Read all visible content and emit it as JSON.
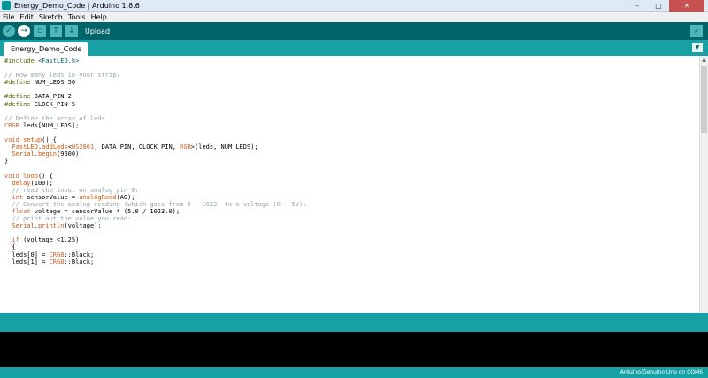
{
  "window": {
    "title": "Energy_Demo_Code | Arduino 1.8.6",
    "minimize": "–",
    "maximize": "□",
    "close": "✕"
  },
  "menu": [
    "File",
    "Edit",
    "Sketch",
    "Tools",
    "Help"
  ],
  "toolbar": {
    "hover_label": "Upload"
  },
  "tabs": [
    {
      "label": "Energy_Demo_Code"
    }
  ],
  "code_lines": [
    [
      [
        "dir",
        "#include "
      ],
      [
        "lit",
        "<FastLED.h>"
      ]
    ],
    [],
    [
      [
        "cmt",
        "// How many leds in your strip?"
      ]
    ],
    [
      [
        "dir",
        "#define "
      ],
      [
        "",
        "NUM_LEDS 50"
      ]
    ],
    [],
    [
      [
        "dir",
        "#define "
      ],
      [
        "",
        "DATA_PIN 2"
      ]
    ],
    [
      [
        "dir",
        "#define "
      ],
      [
        "",
        "CLOCK_PIN 5"
      ]
    ],
    [],
    [
      [
        "cmt",
        "// Define the array of leds"
      ]
    ],
    [
      [
        "type",
        "CRGB"
      ],
      [
        "",
        " leds[NUM_LEDS];"
      ]
    ],
    [],
    [
      [
        "type",
        "void"
      ],
      [
        "",
        " "
      ],
      [
        "fn",
        "setup"
      ],
      [
        "",
        "() {"
      ]
    ],
    [
      [
        "",
        "  "
      ],
      [
        "fn",
        "FastLED"
      ],
      [
        "",
        "."
      ],
      [
        "fn",
        "addLeds"
      ],
      [
        "",
        "<"
      ],
      [
        "type",
        "WS2801"
      ],
      [
        "",
        ", DATA_PIN, CLOCK_PIN, "
      ],
      [
        "type",
        "RGB"
      ],
      [
        "",
        ">(leds, NUM_LEDS);"
      ]
    ],
    [
      [
        "",
        "  "
      ],
      [
        "fn",
        "Serial"
      ],
      [
        "",
        "."
      ],
      [
        "fn",
        "begin"
      ],
      [
        "",
        "(9600);"
      ]
    ],
    [
      [
        "",
        "}"
      ]
    ],
    [],
    [
      [
        "type",
        "void"
      ],
      [
        "",
        " "
      ],
      [
        "fn",
        "loop"
      ],
      [
        "",
        "() {"
      ]
    ],
    [
      [
        "",
        "  "
      ],
      [
        "fn",
        "delay"
      ],
      [
        "",
        "(100);"
      ]
    ],
    [
      [
        "",
        "  "
      ],
      [
        "cmt",
        "// read the input on analog pin 0:"
      ]
    ],
    [
      [
        "",
        "  "
      ],
      [
        "type",
        "int"
      ],
      [
        "",
        " sensorValue = "
      ],
      [
        "fn",
        "analogRead"
      ],
      [
        "",
        "(A0);"
      ]
    ],
    [
      [
        "",
        "  "
      ],
      [
        "cmt",
        "// Convert the analog reading (which goes from 0 - 1023) to a voltage (0 - 5V):"
      ]
    ],
    [
      [
        "",
        "  "
      ],
      [
        "type",
        "float"
      ],
      [
        "",
        " voltage = sensorValue * (5.0 / 1023.0);"
      ]
    ],
    [
      [
        "",
        "  "
      ],
      [
        "cmt",
        "// print out the value you read:"
      ]
    ],
    [
      [
        "",
        "  "
      ],
      [
        "fn",
        "Serial"
      ],
      [
        "",
        "."
      ],
      [
        "fn",
        "println"
      ],
      [
        "",
        "(voltage);"
      ]
    ],
    [],
    [
      [
        "",
        "  "
      ],
      [
        "type",
        "if"
      ],
      [
        "",
        " (voltage <1.25)"
      ]
    ],
    [
      [
        "",
        "  {"
      ]
    ],
    [
      [
        "",
        "  leds[0] = "
      ],
      [
        "type",
        "CRGB"
      ],
      [
        "",
        "::Black;"
      ]
    ],
    [
      [
        "",
        "  leds[1] = "
      ],
      [
        "type",
        "CRGB"
      ],
      [
        "",
        "::Black;"
      ]
    ]
  ],
  "status": {
    "board": "Arduino/Genuino Uno on COM6"
  },
  "icons": {
    "verify": "✓",
    "upload": "→",
    "new": "▫",
    "open": "↑",
    "save": "↓",
    "serial_monitor": "⌕",
    "tab_menu": "▼",
    "scroll_up": "▲"
  },
  "colors": {
    "toolbar": "#006468",
    "tabbar": "#17a1a5",
    "console": "#000000",
    "keyword_type": "#cc6633",
    "function": "#d35400",
    "directive": "#5e6d03",
    "comment": "#95a5a6"
  }
}
